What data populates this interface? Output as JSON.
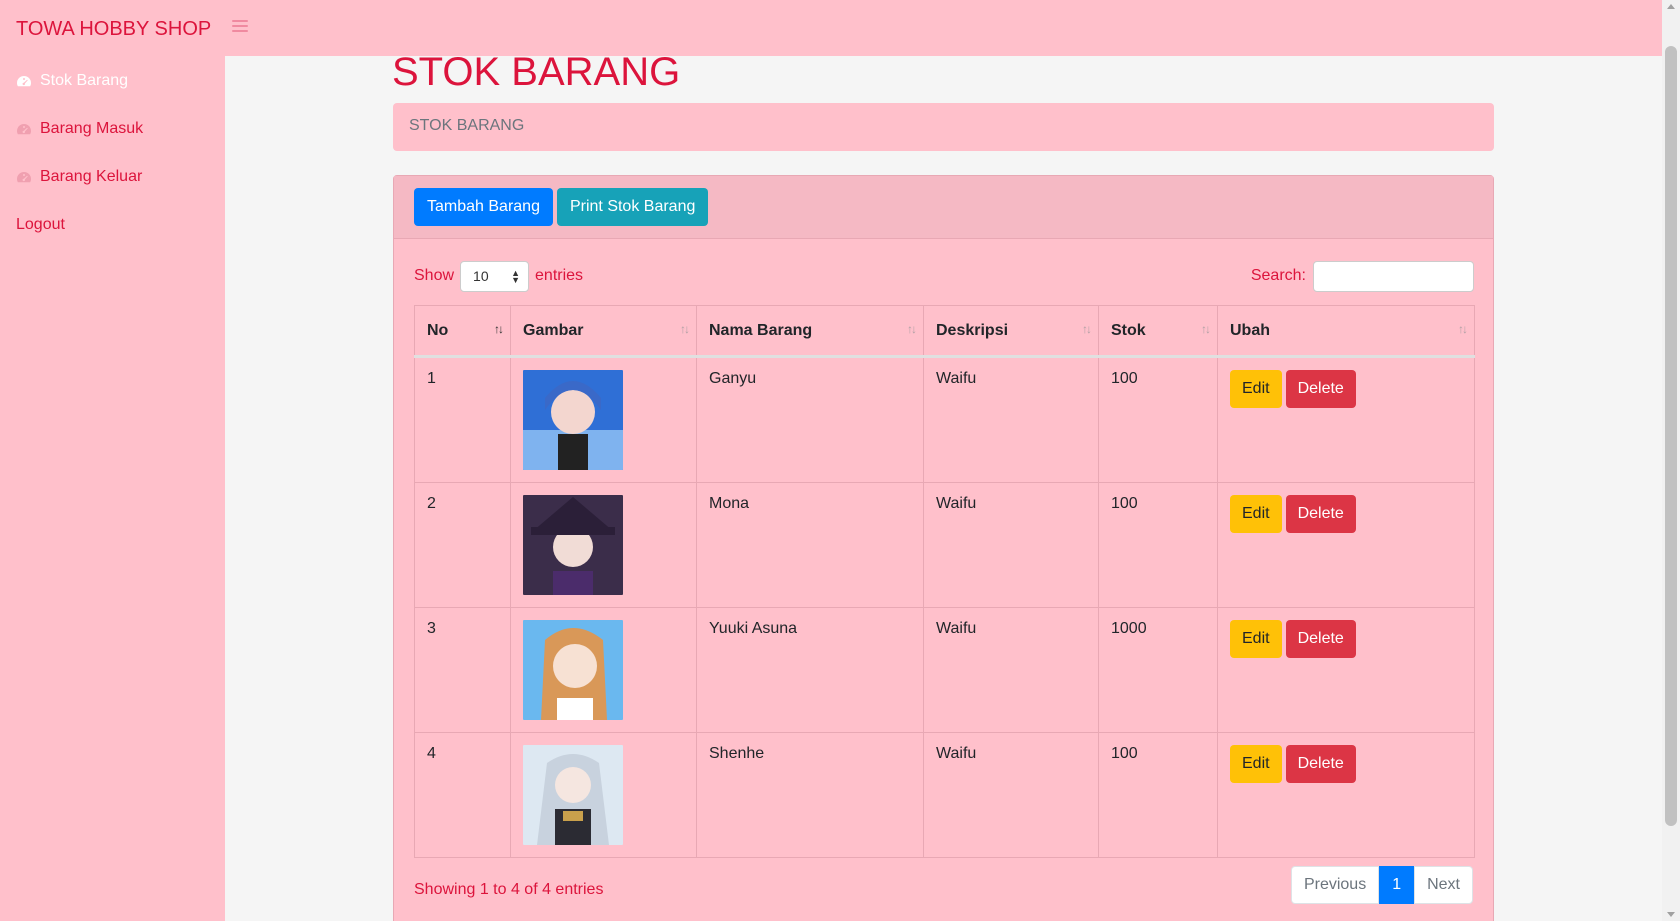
{
  "app": {
    "brand": "TOWA HOBBY SHOP"
  },
  "sidebar": {
    "items": [
      {
        "label": "Stok Barang",
        "icon": "tachometer-icon",
        "active": true
      },
      {
        "label": "Barang Masuk",
        "icon": "tachometer-icon",
        "active": false
      },
      {
        "label": "Barang Keluar",
        "icon": "tachometer-icon",
        "active": false
      },
      {
        "label": "Logout",
        "icon": "",
        "active": false
      }
    ]
  },
  "page": {
    "title": "STOK BARANG",
    "breadcrumb": "STOK BARANG"
  },
  "toolbar": {
    "add_label": "Tambah Barang",
    "print_label": "Print Stok Barang"
  },
  "table_controls": {
    "show_label": "Show",
    "entries_value": "10",
    "entries_label": "entries",
    "search_label": "Search:",
    "search_value": ""
  },
  "table": {
    "columns": [
      "No",
      "Gambar",
      "Nama Barang",
      "Deskripsi",
      "Stok",
      "Ubah"
    ],
    "rows": [
      {
        "no": "1",
        "image": "anime-portrait-blue-hair",
        "name": "Ganyu",
        "desc": "Waifu",
        "stock": "100",
        "edit": "Edit",
        "delete": "Delete"
      },
      {
        "no": "2",
        "image": "anime-portrait-witch-hat",
        "name": "Mona",
        "desc": "Waifu",
        "stock": "100",
        "edit": "Edit",
        "delete": "Delete"
      },
      {
        "no": "3",
        "image": "anime-portrait-orange-hair",
        "name": "Yuuki Asuna",
        "desc": "Waifu",
        "stock": "1000",
        "edit": "Edit",
        "delete": "Delete"
      },
      {
        "no": "4",
        "image": "anime-portrait-silver-hair",
        "name": "Shenhe",
        "desc": "Waifu",
        "stock": "100",
        "edit": "Edit",
        "delete": "Delete"
      }
    ]
  },
  "footer": {
    "info": "Showing 1 to 4 of 4 entries",
    "prev_label": "Previous",
    "current_page": "1",
    "next_label": "Next"
  },
  "colors": {
    "brand": "#dc143c",
    "panel": "#ffc0cb",
    "primary": "#007bff",
    "info": "#17a2b8",
    "warning": "#ffc107",
    "danger": "#dc3545"
  }
}
